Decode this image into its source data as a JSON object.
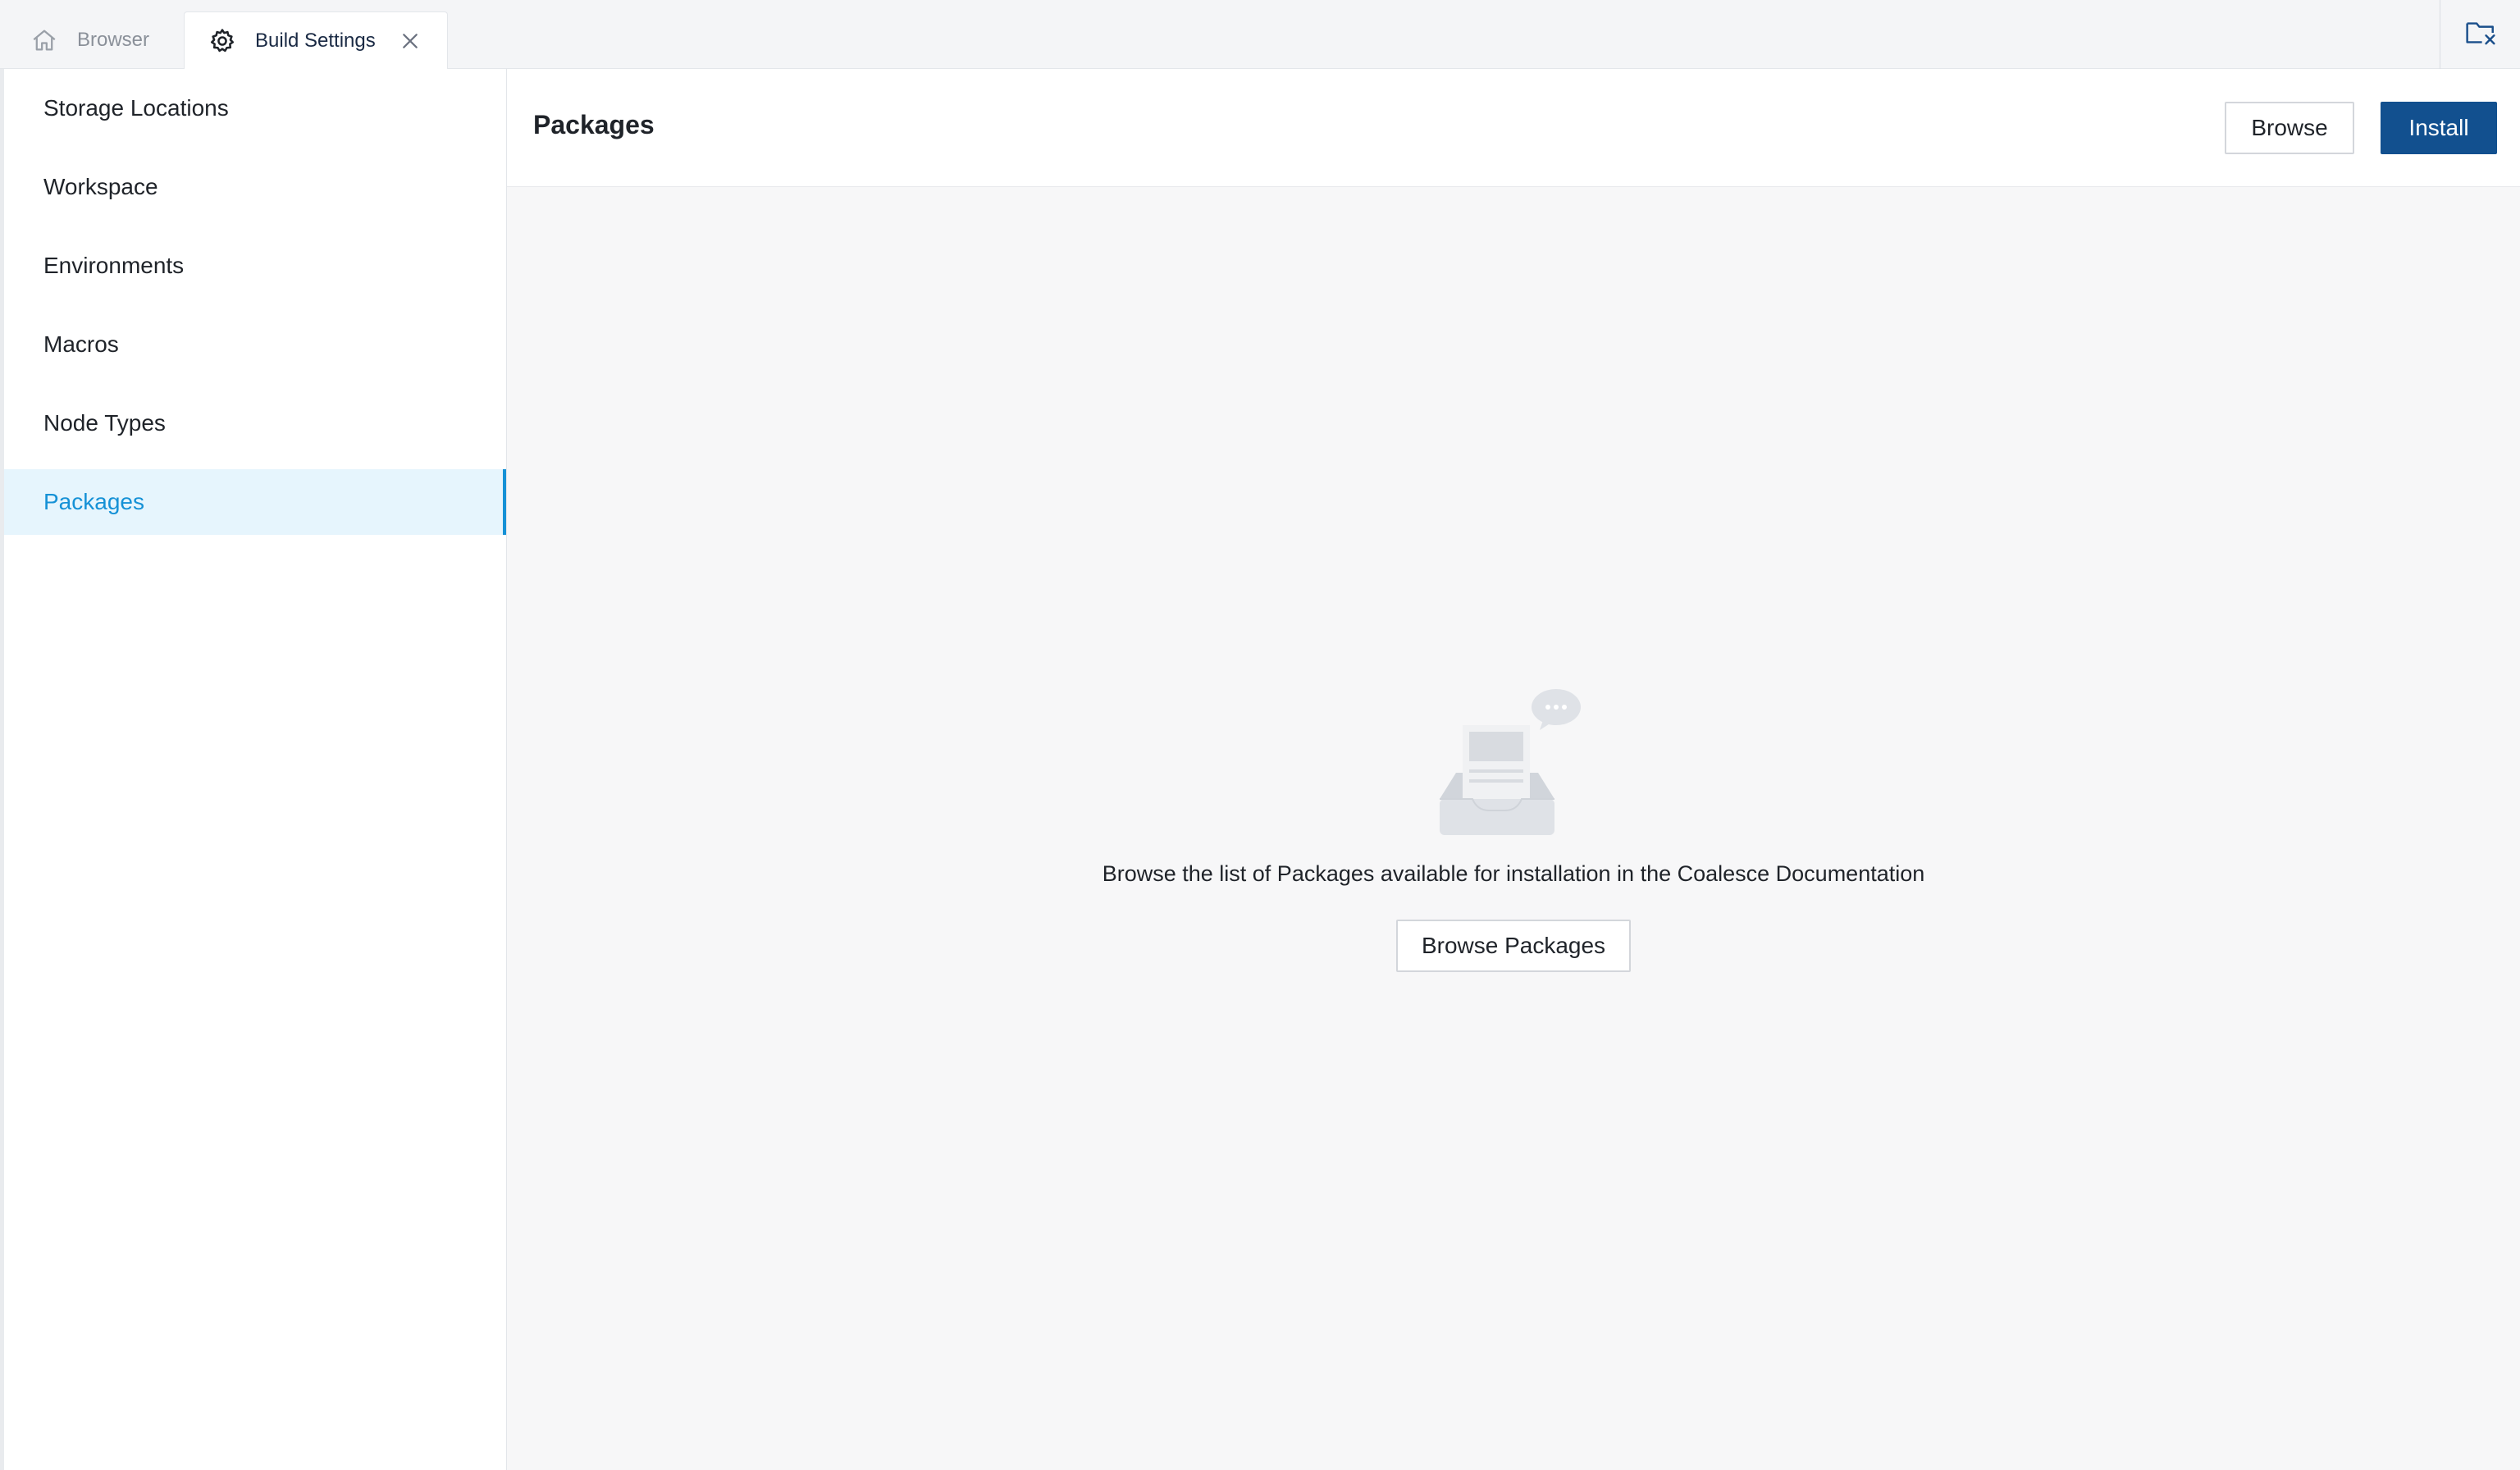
{
  "tabs": [
    {
      "label": "Browser",
      "icon": "home-icon",
      "active": false
    },
    {
      "label": "Build Settings",
      "icon": "gear-icon",
      "active": true,
      "closable": true
    }
  ],
  "corner_action": {
    "icon": "folder-close-icon"
  },
  "sidebar": {
    "items": [
      {
        "label": "Storage Locations",
        "active": false
      },
      {
        "label": "Workspace",
        "active": false
      },
      {
        "label": "Environments",
        "active": false
      },
      {
        "label": "Macros",
        "active": false
      },
      {
        "label": "Node Types",
        "active": false
      },
      {
        "label": "Packages",
        "active": true
      }
    ]
  },
  "main": {
    "title": "Packages",
    "browse_label": "Browse",
    "install_label": "Install",
    "empty_state": {
      "icon": "inbox-illustration-icon",
      "message": "Browse the list of Packages available for installation in the Coalesce Documentation",
      "button_label": "Browse Packages"
    }
  },
  "colors": {
    "accent": "#1591d6",
    "active_bg": "#e6f5fd",
    "primary_button": "#12508f"
  }
}
